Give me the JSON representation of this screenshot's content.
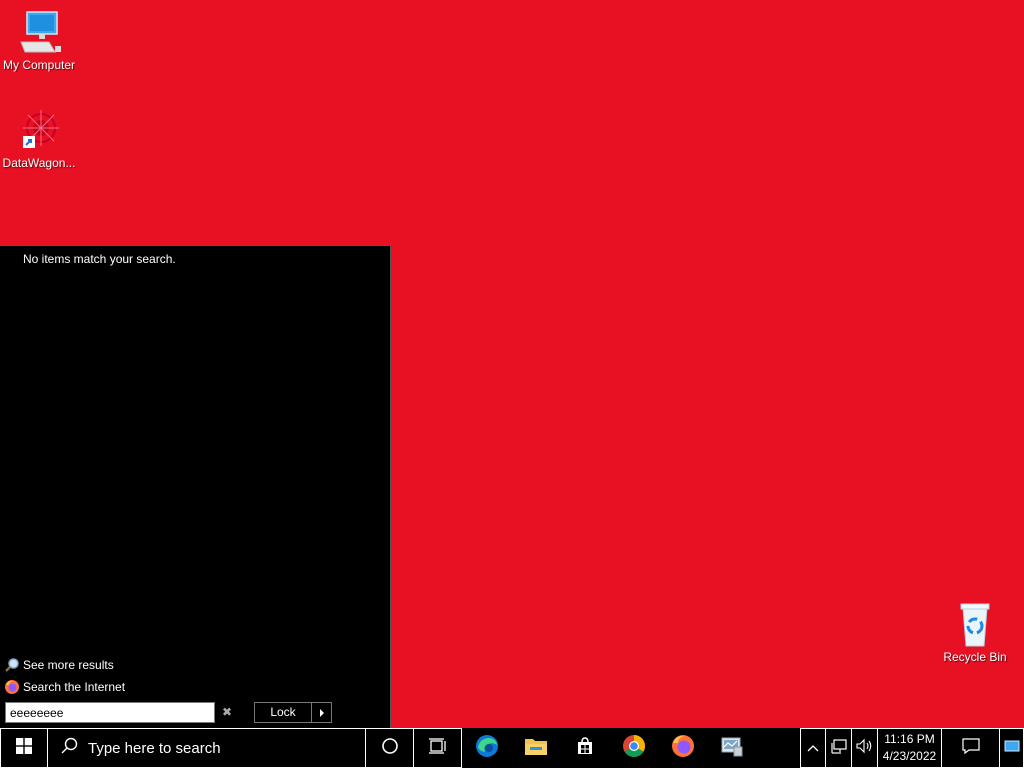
{
  "desktop": {
    "background_color": "#e81123",
    "icons": [
      {
        "label": "My Computer",
        "icon": "monitor-icon"
      },
      {
        "label": "DataWagon...",
        "icon": "datawagon-shortcut-icon"
      },
      {
        "label": "Recycle Bin",
        "icon": "recycle-bin-icon"
      }
    ]
  },
  "start_menu": {
    "no_results_text": "No items match your search.",
    "see_more_label": "See more results",
    "search_internet_label": "Search the Internet",
    "search_value": "eeeeeeee",
    "lock_label": "Lock"
  },
  "taskbar": {
    "search_placeholder": "Type here to search",
    "pinned_apps": [
      "edge-icon",
      "file-explorer-icon",
      "store-icon",
      "chrome-icon",
      "firefox-icon",
      "server-manager-icon"
    ],
    "clock": {
      "time": "11:16 PM",
      "date": "4/23/2022"
    }
  }
}
